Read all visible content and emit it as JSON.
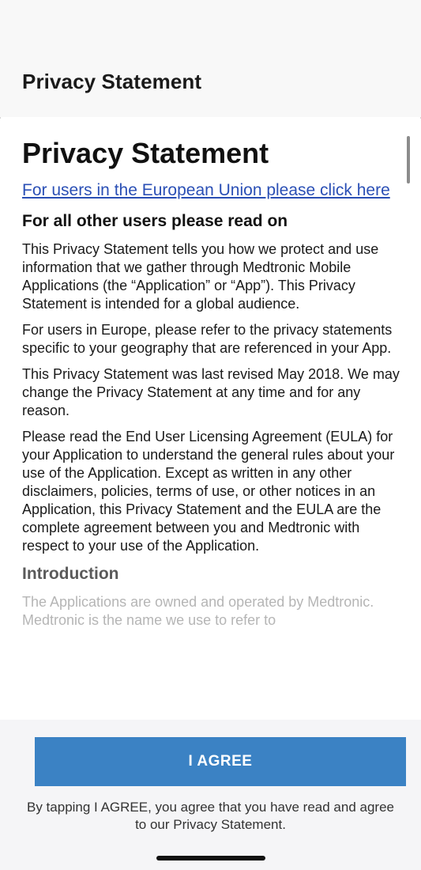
{
  "header": {
    "title": "Privacy Statement"
  },
  "document": {
    "title": "Privacy Statement",
    "eu_link": "For users in the European Union please click here",
    "subtitle": "For all other users please read on",
    "paragraphs": [
      "This Privacy Statement tells you how we protect and use information that we gather through Medtronic Mobile Applications (the “Application” or “App”). This Privacy Statement is intended for a global audience.",
      "For users in Europe, please refer to the privacy statements specific to your geography that are referenced in your App.",
      "This Privacy Statement was last revised May 2018. We may change the Privacy Statement at any time and for any reason.",
      "Please read the End User Licensing Agreement (EULA) for your Application to understand the general rules about your use of the Application. Except as written in any other disclaimers, policies, terms of use, or other notices in an Application, this Privacy Statement and the EULA are the complete agreement between you and Medtronic with respect to your use of the Application."
    ],
    "section_heading": "Introduction",
    "section_intro": "The Applications are owned and operated by Medtronic. Medtronic is the name we use to refer to"
  },
  "footer": {
    "agree_label": "I AGREE",
    "disclaimer": "By tapping I AGREE, you agree that you have read and agree to our Privacy Statement."
  },
  "colors": {
    "accent": "#3b82c4",
    "link": "#2a4fb5",
    "header_bg": "#f8f8f8",
    "footer_bg": "#f5f5f7"
  }
}
